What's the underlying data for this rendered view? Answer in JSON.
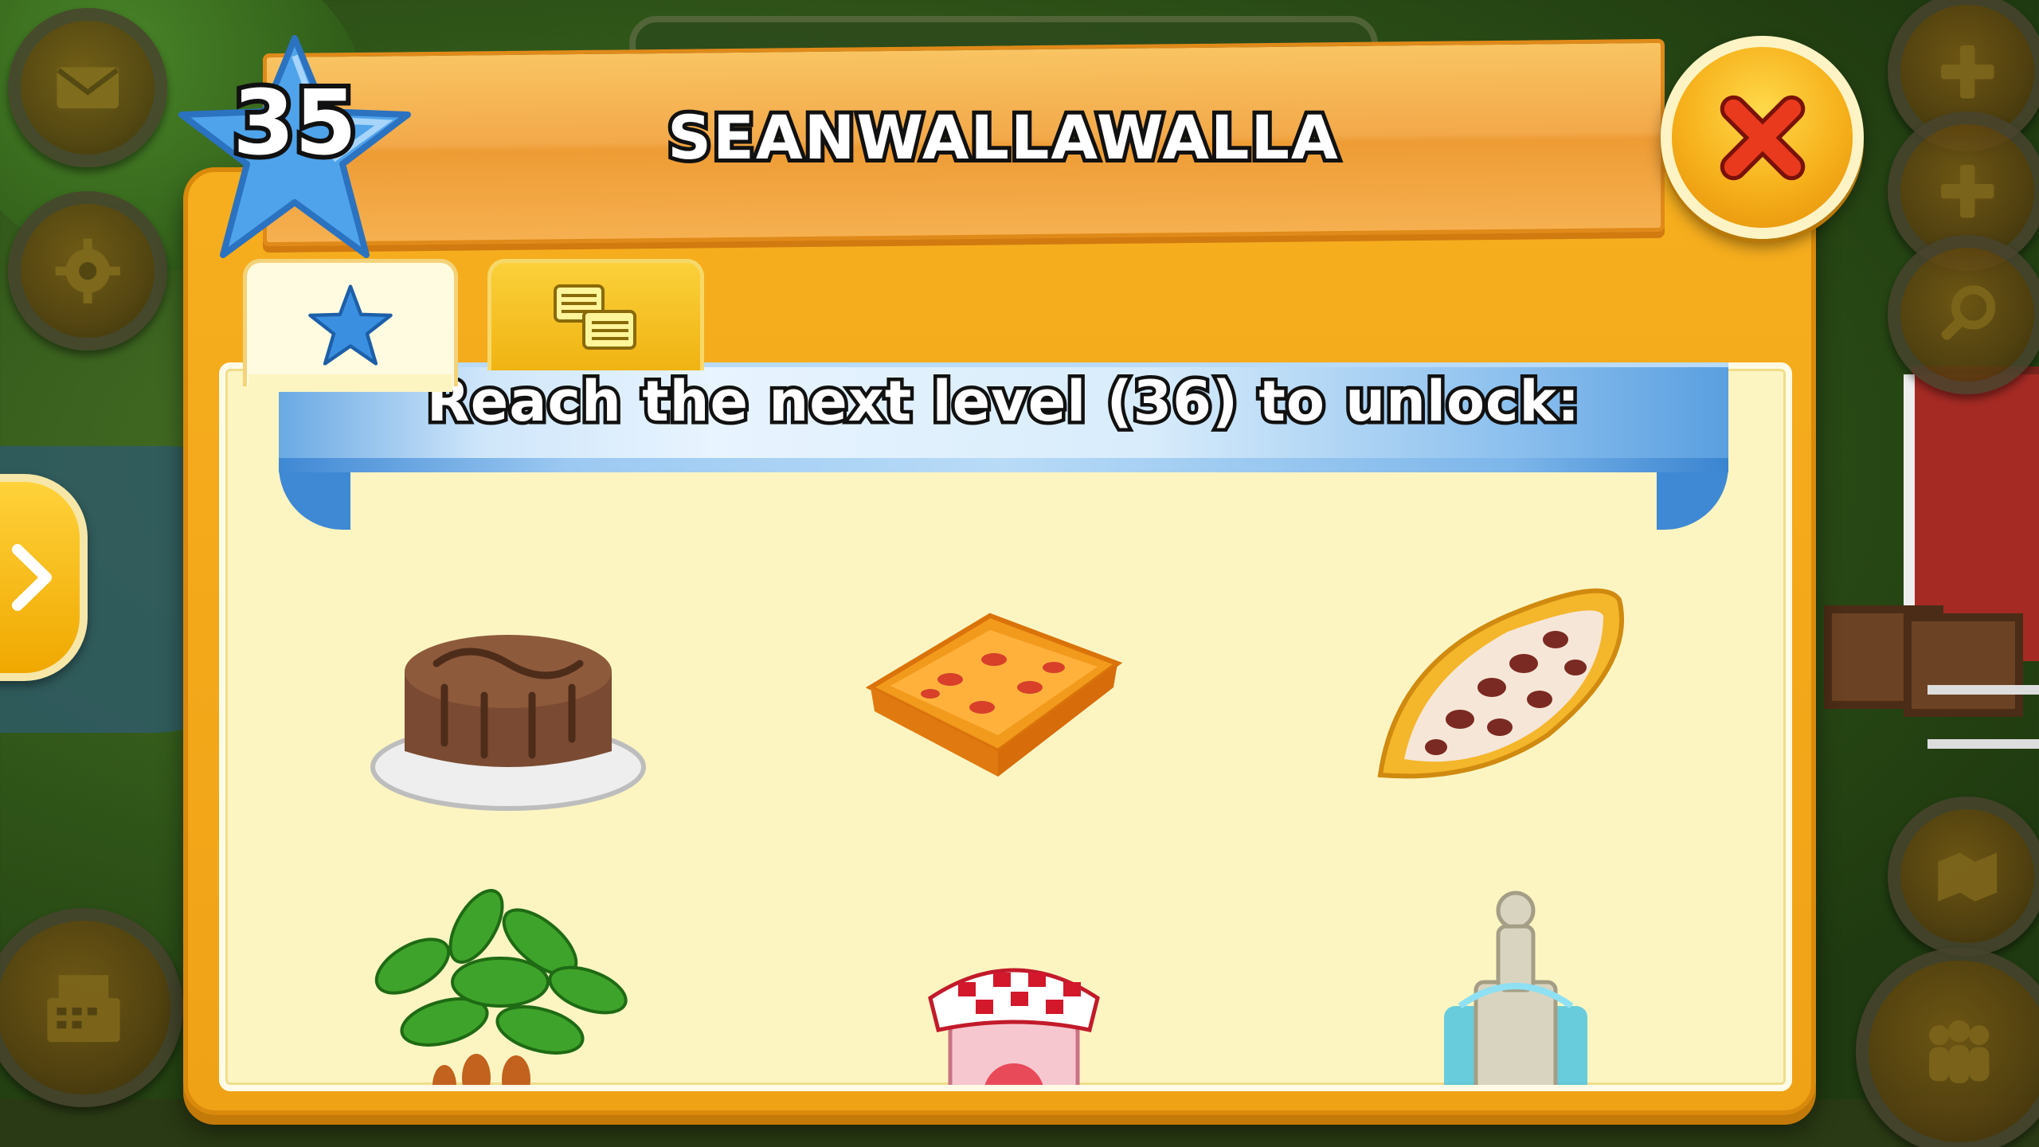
{
  "header": {
    "level": "35",
    "player_name": "SEANWALLAWALLA"
  },
  "tabs": [
    {
      "id": "stats",
      "icon": "star-icon",
      "active": true
    },
    {
      "id": "log",
      "icon": "list-icon",
      "active": false
    }
  ],
  "unlock_banner": {
    "text": "Reach the next level (36) to unlock:"
  },
  "unlocks": [
    {
      "icon": "chocolate-cake-icon"
    },
    {
      "icon": "casserole-dish-icon"
    },
    {
      "icon": "cacao-pod-icon"
    },
    {
      "icon": "cacao-tree-icon"
    },
    {
      "icon": "jam-jar-icon"
    },
    {
      "icon": "fountain-icon"
    }
  ],
  "hud_left": [
    "mail-icon",
    "gear-icon",
    "cash-register-icon"
  ],
  "hud_right": [
    "plus-icon",
    "plus-icon",
    "magnifier-icon",
    "map-icon",
    "friends-icon"
  ],
  "colors": {
    "dialog_orange": "#f6ae1e",
    "panel_cream": "#fcf5c2",
    "ribbon_blue": "#6aa9e4",
    "close_red": "#e8341c",
    "star_blue": "#3a8fe0"
  }
}
